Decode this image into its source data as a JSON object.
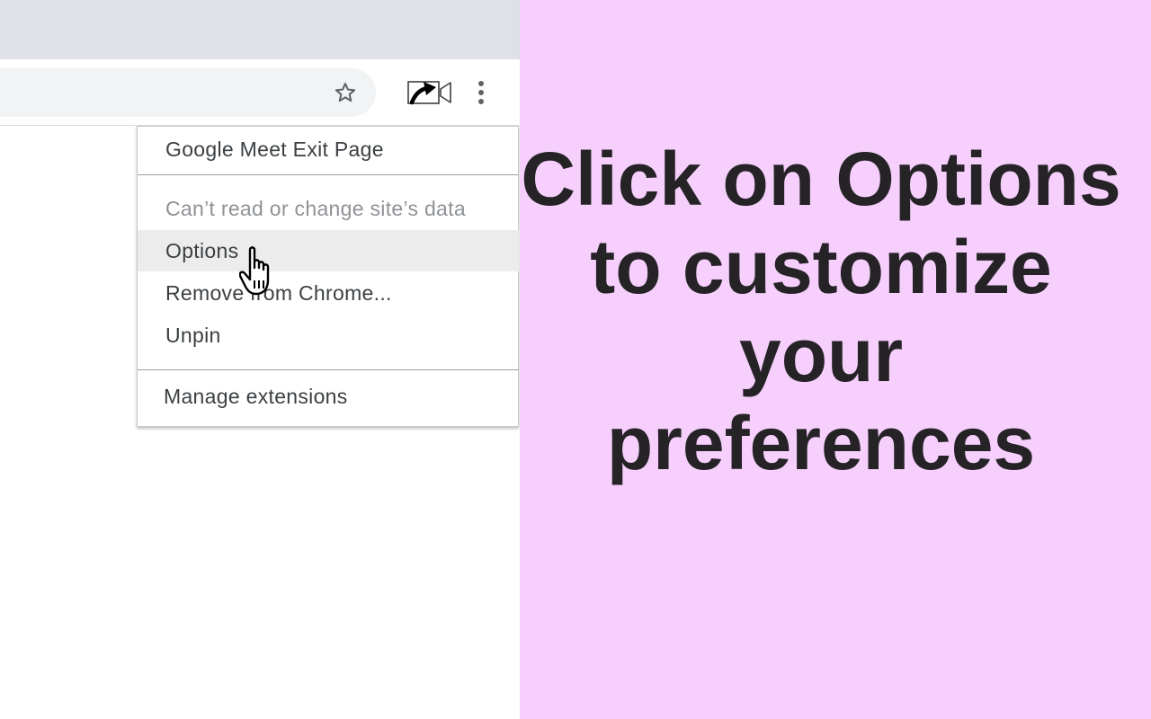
{
  "menu": {
    "title": "Google Meet Exit Page",
    "site_access": "Can’t read or change site’s data",
    "options": "Options",
    "remove": "Remove from Chrome...",
    "unpin": "Unpin",
    "manage": "Manage extensions"
  },
  "promo": {
    "headline": "Click on Options to customize your preferences",
    "background_color": "#f6cffc"
  },
  "icons": {
    "bookmark": "star-icon",
    "extension": "meet-exit-extension-icon",
    "more": "kebab-menu-icon",
    "cursor": "hand-pointer-cursor"
  }
}
